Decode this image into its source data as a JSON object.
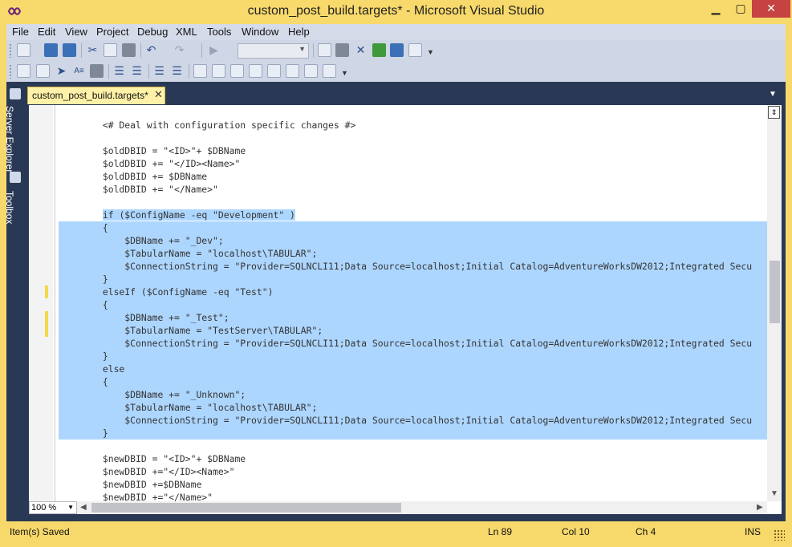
{
  "window": {
    "title": "custom_post_build.targets* - Microsoft Visual Studio"
  },
  "menu": [
    "File",
    "Edit",
    "View",
    "Project",
    "Debug",
    "XML",
    "Tools",
    "Window",
    "Help"
  ],
  "side_panels": [
    "Server Explorer",
    "Toolbox"
  ],
  "document_tab": {
    "label": "custom_post_build.targets*",
    "close": "✕"
  },
  "code_lines": [
    {
      "text": "        <# Deal with configuration specific changes #>",
      "sel": "none"
    },
    {
      "text": "",
      "sel": "none"
    },
    {
      "text": "        $oldDBID = \"<ID>\"+ $DBName",
      "sel": "none"
    },
    {
      "text": "        $oldDBID += \"</ID><Name>\"",
      "sel": "none"
    },
    {
      "text": "        $oldDBID += $DBName",
      "sel": "none"
    },
    {
      "text": "        $oldDBID += \"</Name>\"",
      "sel": "none"
    },
    {
      "text": "",
      "sel": "none"
    },
    {
      "text": "        if ($ConfigName -eq \"Development\" )",
      "sel": "part"
    },
    {
      "text": "        {",
      "sel": "full"
    },
    {
      "text": "            $DBName += \"_Dev\";",
      "sel": "full"
    },
    {
      "text": "            $TabularName = \"localhost\\TABULAR\";",
      "sel": "full"
    },
    {
      "text": "            $ConnectionString = \"Provider=SQLNCLI11;Data Source=localhost;Initial Catalog=AdventureWorksDW2012;Integrated Secu",
      "sel": "full"
    },
    {
      "text": "        }",
      "sel": "full"
    },
    {
      "text": "        elseIf ($ConfigName -eq \"Test\")",
      "sel": "full"
    },
    {
      "text": "        {",
      "sel": "full"
    },
    {
      "text": "            $DBName += \"_Test\";",
      "sel": "full"
    },
    {
      "text": "            $TabularName = \"TestServer\\TABULAR\";",
      "sel": "full"
    },
    {
      "text": "            $ConnectionString = \"Provider=SQLNCLI11;Data Source=localhost;Initial Catalog=AdventureWorksDW2012;Integrated Secu",
      "sel": "full"
    },
    {
      "text": "        }",
      "sel": "full"
    },
    {
      "text": "        else",
      "sel": "full"
    },
    {
      "text": "        {",
      "sel": "full"
    },
    {
      "text": "            $DBName += \"_Unknown\";",
      "sel": "full"
    },
    {
      "text": "            $TabularName = \"localhost\\TABULAR\";",
      "sel": "full"
    },
    {
      "text": "            $ConnectionString = \"Provider=SQLNCLI11;Data Source=localhost;Initial Catalog=AdventureWorksDW2012;Integrated Secu",
      "sel": "full"
    },
    {
      "text": "        }",
      "sel": "full"
    },
    {
      "text": "",
      "sel": "none"
    },
    {
      "text": "        $newDBID = \"<ID>\"+ $DBName",
      "sel": "none"
    },
    {
      "text": "        $newDBID +=\"</ID><Name>\"",
      "sel": "none"
    },
    {
      "text": "        $newDBID +=$DBName",
      "sel": "none"
    },
    {
      "text": "        $newDBID +=\"</Name>\"",
      "sel": "none"
    }
  ],
  "zoom": {
    "value": "100 %"
  },
  "status": {
    "message": "Item(s) Saved",
    "line": "Ln 89",
    "col": "Col 10",
    "ch": "Ch 4",
    "mode": "INS"
  },
  "colors": {
    "frame": "#f7d86a",
    "workspace": "#293955",
    "selection": "#add6ff"
  }
}
